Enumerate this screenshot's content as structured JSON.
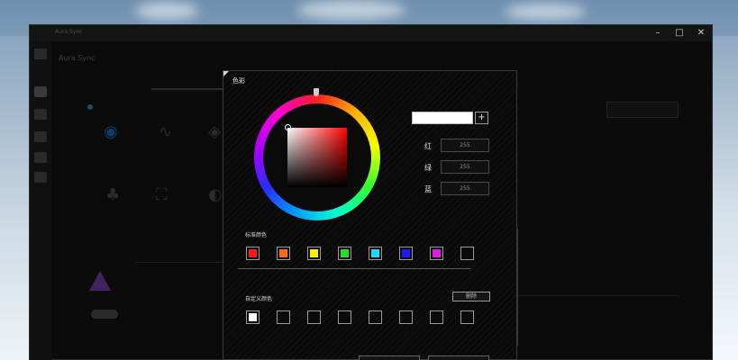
{
  "app": {
    "title": "Aura Sync",
    "window_controls": [
      "–",
      "□",
      "✕"
    ]
  },
  "dialog": {
    "title": "色彩",
    "preview_color": "#ffffff",
    "add_label": "+",
    "rgb": {
      "red_label": "红",
      "red_value": "255",
      "green_label": "绿",
      "green_value": "255",
      "blue_label": "蓝",
      "blue_value": "255"
    },
    "standard_colors_label": "标准颜色",
    "standard_colors": [
      "#ff1a1a",
      "#ff6a1a",
      "#ffee00",
      "#22e022",
      "#1ad8ff",
      "#1a1aff",
      "#e01ae0",
      "#0a0a0a"
    ],
    "custom_colors_label": "自定义颜色",
    "delete_label": "删除",
    "custom_colors": [
      "#ffffff",
      "#0a0a0a",
      "#0a0a0a",
      "#0a0a0a",
      "#0a0a0a",
      "#0a0a0a",
      "#0a0a0a",
      "#0a0a0a"
    ]
  }
}
